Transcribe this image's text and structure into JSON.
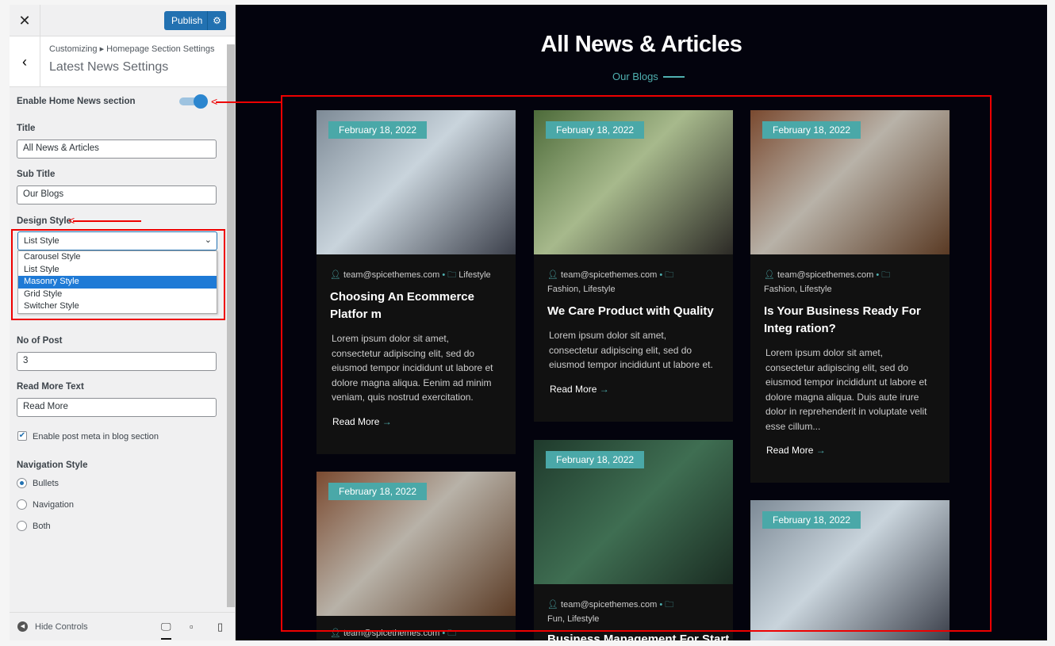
{
  "panel": {
    "close": "✕",
    "publish": "Publish",
    "publish_gear": "⚙",
    "breadcrumb": "Customizing ▸ Homepage Section Settings",
    "section_title": "Latest News Settings",
    "enable_label": "Enable Home News section",
    "enable_on": true,
    "title_label": "Title",
    "title_value": "All News & Articles",
    "subtitle_label": "Sub Title",
    "subtitle_value": "Our Blogs",
    "design_label": "Design Style",
    "design_value": "List Style",
    "design_options": [
      "Carousel Style",
      "List Style",
      "Masonry Style",
      "Grid Style",
      "Switcher Style"
    ],
    "design_highlighted": "Masonry Style",
    "posts_label": "No of Post",
    "posts_value": "3",
    "readmore_label": "Read More Text",
    "readmore_value": "Read More",
    "meta_label": "Enable post meta in blog section",
    "meta_checked": true,
    "nav_label": "Navigation Style",
    "nav_options": [
      "Bullets",
      "Navigation",
      "Both"
    ],
    "nav_selected": "Bullets",
    "hide_controls": "Hide Controls"
  },
  "preview": {
    "title": "All News & Articles",
    "subtitle": "Our Blogs",
    "cards": [
      {
        "date": "February 18, 2022",
        "author": "team@spicethemes.com",
        "category": "Lifestyle",
        "title": "Choosing An Ecommerce Platfor m",
        "excerpt": "Lorem ipsum dolor sit amet, consectetur adipiscing elit, sed do eiusmod tempor incididunt ut labore et dolore magna aliqua. Eenim ad minim veniam, quis nostrud exercitation.",
        "read_more": "Read More"
      },
      {
        "date": "February 18, 2022",
        "author": "team@spicethemes.com",
        "category": "Fashion, Lifestyle",
        "title": "We Care Product with Quality",
        "excerpt": "Lorem ipsum dolor sit amet, consectetur adipiscing elit, sed do eiusmod tempor incididunt ut labore et.",
        "read_more": "Read More"
      },
      {
        "date": "February 18, 2022",
        "author": "team@spicethemes.com",
        "category": "Fashion, Lifestyle",
        "title": "Is Your Business Ready For Integ ration?",
        "excerpt": "Lorem ipsum dolor sit amet, consectetur adipiscing elit, sed do eiusmod tempor incididunt ut labore et dolore magna aliqua. Duis aute irure dolor in reprehenderit in voluptate velit esse cillum...",
        "read_more": "Read More"
      },
      {
        "date": "February 18, 2022",
        "author": "team@spicethemes.com",
        "category": ""
      },
      {
        "date": "February 18, 2022",
        "author": "team@spicethemes.com",
        "category": "Fun, Lifestyle",
        "title": "Business Management For Start"
      },
      {
        "date": "February 18, 2022"
      }
    ]
  }
}
